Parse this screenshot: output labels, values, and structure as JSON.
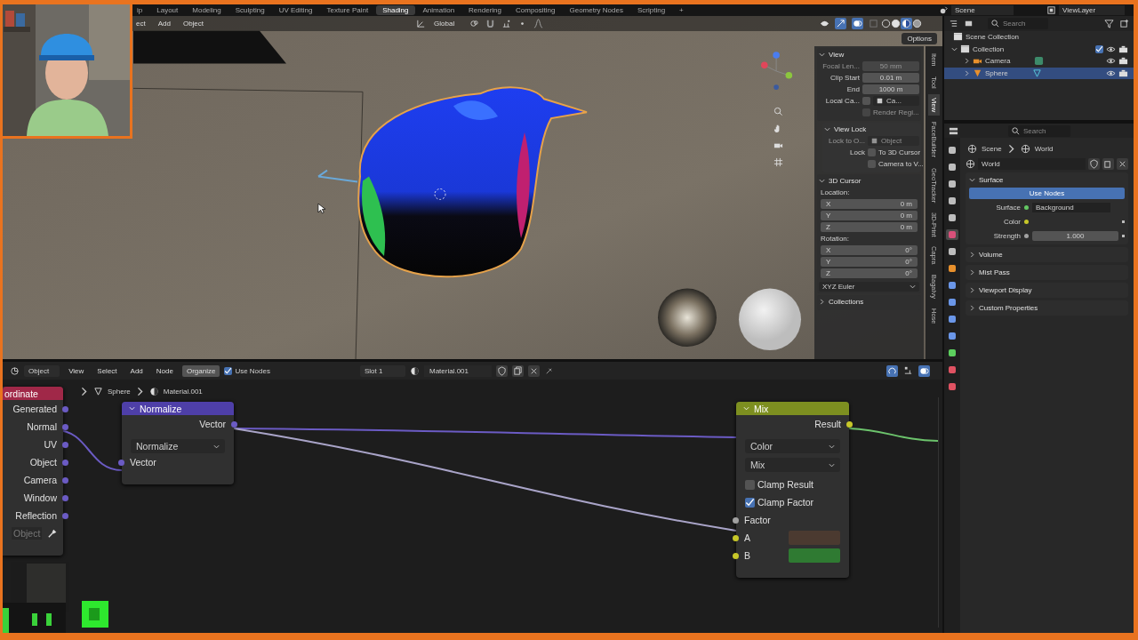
{
  "topbar": {
    "tabs": [
      {
        "label": "ip",
        "selected": false
      },
      {
        "label": "Layout",
        "selected": false
      },
      {
        "label": "Modeling",
        "selected": false
      },
      {
        "label": "Sculpting",
        "selected": false
      },
      {
        "label": "UV Editing",
        "selected": false
      },
      {
        "label": "Texture Paint",
        "selected": false
      },
      {
        "label": "Shading",
        "selected": true
      },
      {
        "label": "Animation",
        "selected": false
      },
      {
        "label": "Rendering",
        "selected": false
      },
      {
        "label": "Compositing",
        "selected": false
      },
      {
        "label": "Geometry Nodes",
        "selected": false
      },
      {
        "label": "Scripting",
        "selected": false
      }
    ],
    "add_tab": "+",
    "scene": "Scene",
    "view_layer": "ViewLayer"
  },
  "viewport": {
    "menus": [
      "ect",
      "Add",
      "Object"
    ],
    "orientation": "Global",
    "shading_modes": [
      {
        "kind": "wireframe",
        "selected": false
      },
      {
        "kind": "solid",
        "selected": false
      },
      {
        "kind": "material",
        "selected": true
      },
      {
        "kind": "rendered",
        "selected": false
      }
    ],
    "options": "Options",
    "sidebar": {
      "tabs": [
        {
          "label": "Item",
          "selected": false
        },
        {
          "label": "Tool",
          "selected": false
        },
        {
          "label": "View",
          "selected": true
        },
        {
          "label": "FaceBuilder",
          "selected": false
        },
        {
          "label": "GeoTracker",
          "selected": false
        },
        {
          "label": "3D-Print",
          "selected": false
        },
        {
          "label": "Capra",
          "selected": false
        },
        {
          "label": "BagaIvy",
          "selected": false
        },
        {
          "label": "Hose",
          "selected": false
        }
      ],
      "panels": [
        {
          "title": "View",
          "expanded": true,
          "rows": [
            {
              "kind": "field",
              "label": "Focal Len...",
              "value": "50 mm",
              "disabled": true
            },
            {
              "kind": "field",
              "label": "Clip Start",
              "value": "0.01 m",
              "disabled": false
            },
            {
              "kind": "field",
              "label": "End",
              "value": "1000 m",
              "disabled": false
            },
            {
              "kind": "picker",
              "label": "Local Ca...",
              "value": "Ca...",
              "checked": false,
              "disabled": false
            },
            {
              "kind": "check",
              "text": "Render Regi...",
              "checked": false,
              "disabled": true
            }
          ]
        },
        {
          "title": "View Lock",
          "expanded": true,
          "sub": true,
          "rows": [
            {
              "kind": "picker",
              "label": "Lock to O...",
              "value": "Object",
              "disabled": true
            },
            {
              "kind": "check",
              "label": "Lock",
              "text": "To 3D Cursor",
              "checked": false,
              "disabled": false
            },
            {
              "kind": "check",
              "text": "Camera to V...",
              "checked": false,
              "disabled": false
            }
          ]
        },
        {
          "title": "3D Cursor",
          "expanded": true,
          "rows": [
            {
              "kind": "heading",
              "text": "Location:"
            },
            {
              "kind": "axis",
              "label": "X",
              "value": "0 m"
            },
            {
              "kind": "axis",
              "label": "Y",
              "value": "0 m"
            },
            {
              "kind": "axis",
              "label": "Z",
              "value": "0 m"
            },
            {
              "kind": "heading",
              "text": "Rotation:"
            },
            {
              "kind": "axis",
              "label": "X",
              "value": "0°"
            },
            {
              "kind": "axis",
              "label": "Y",
              "value": "0°"
            },
            {
              "kind": "axis",
              "label": "Z",
              "value": "0°"
            },
            {
              "kind": "dropdown",
              "value": "XYZ Euler"
            }
          ]
        },
        {
          "title": "Collections",
          "expanded": false
        }
      ]
    }
  },
  "node_editor": {
    "mode": "Object",
    "menus": [
      "View",
      "Select",
      "Add",
      "Node"
    ],
    "organize": "Organize",
    "use_nodes": {
      "label": "Use Nodes",
      "checked": true
    },
    "slot": "Slot 1",
    "material": "Material.001",
    "breadcrumb": [
      {
        "kind": "mesh",
        "label": "Sphere"
      },
      {
        "kind": "material",
        "label": "Material.001"
      }
    ],
    "tex_coord": {
      "title": "ordinate",
      "outputs": [
        "Generated",
        "Normal",
        "UV",
        "Object",
        "Camera",
        "Window",
        "Reflection"
      ],
      "object_field": "Object"
    },
    "normalize": {
      "title": "Normalize",
      "output": "Vector",
      "operation": "Normalize",
      "input": "Vector"
    },
    "mix": {
      "title": "Mix",
      "output": "Result",
      "data_type": "Color",
      "blend": "Mix",
      "toggles": [
        {
          "label": "Clamp Result",
          "checked": false
        },
        {
          "label": "Clamp Factor",
          "checked": true
        }
      ],
      "inputs": [
        {
          "kind": "value",
          "label": "Factor"
        },
        {
          "kind": "color",
          "label": "A",
          "color": "#4b3a30"
        },
        {
          "kind": "color",
          "label": "B",
          "color": "#2f7a32"
        }
      ]
    }
  },
  "outliner": {
    "placeholder": "Search",
    "root": "Scene Collection",
    "items": [
      {
        "kind": "collection",
        "label": "Collection",
        "expanded": true,
        "selected": false,
        "checked": true,
        "children": [
          {
            "kind": "camera",
            "label": "Camera",
            "expanded": false,
            "selected": false
          },
          {
            "kind": "mesh",
            "label": "Sphere",
            "expanded": false,
            "selected": true
          }
        ]
      }
    ]
  },
  "properties": {
    "placeholder": "Search",
    "tabs": [
      {
        "kind": "tool",
        "selected": false
      },
      {
        "kind": "render",
        "selected": false
      },
      {
        "kind": "output",
        "selected": false
      },
      {
        "kind": "view_layer",
        "selected": false
      },
      {
        "kind": "scene",
        "selected": false
      },
      {
        "kind": "world",
        "selected": true
      },
      {
        "kind": "collection",
        "selected": false
      },
      {
        "kind": "object",
        "selected": false
      },
      {
        "kind": "modifier",
        "selected": false
      },
      {
        "kind": "particles",
        "selected": false
      },
      {
        "kind": "physics",
        "selected": false
      },
      {
        "kind": "constraints",
        "selected": false
      },
      {
        "kind": "data",
        "selected": false
      },
      {
        "kind": "material",
        "selected": false
      },
      {
        "kind": "texture",
        "selected": false
      }
    ],
    "breadcrumb": [
      "Scene",
      "World"
    ],
    "world": "World",
    "panels": [
      {
        "title": "Surface",
        "expanded": true,
        "rows": [
          {
            "kind": "button",
            "label": "Use Nodes",
            "on": true
          },
          {
            "kind": "link",
            "label": "Surface",
            "value": "Background"
          },
          {
            "kind": "color",
            "label": "Color"
          },
          {
            "kind": "number",
            "label": "Strength",
            "value": "1.000"
          }
        ]
      },
      {
        "title": "Volume",
        "expanded": false
      },
      {
        "title": "Mist Pass",
        "expanded": false
      },
      {
        "title": "Viewport Display",
        "expanded": false
      },
      {
        "title": "Custom Properties",
        "expanded": false
      }
    ]
  }
}
